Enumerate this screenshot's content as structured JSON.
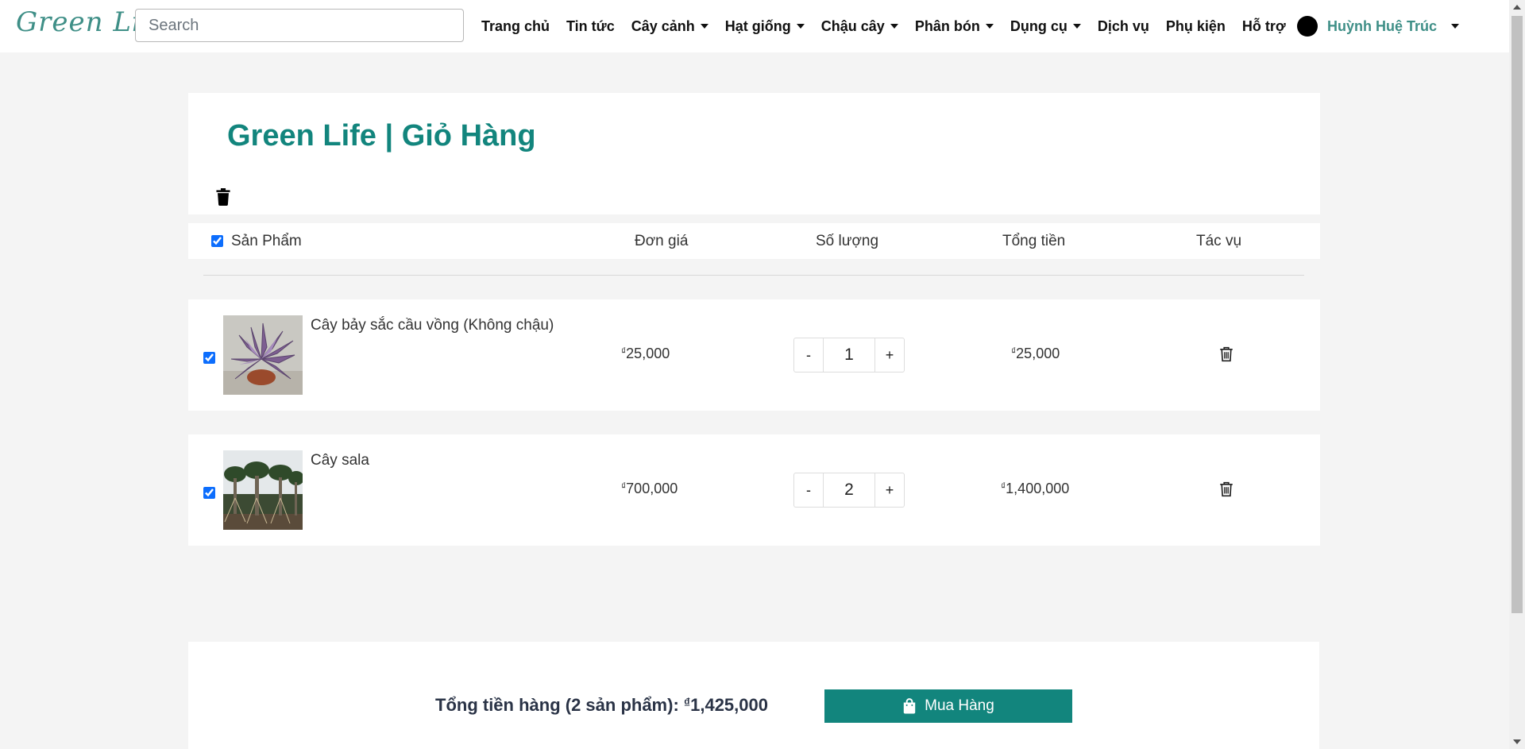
{
  "brand": {
    "logo_text": "Green Life",
    "accent": "#12857d"
  },
  "search": {
    "placeholder": "Search"
  },
  "nav": {
    "items": [
      {
        "label": "Trang chủ",
        "dropdown": false
      },
      {
        "label": "Tin tức",
        "dropdown": false
      },
      {
        "label": "Cây cảnh",
        "dropdown": true
      },
      {
        "label": "Hạt giống",
        "dropdown": true
      },
      {
        "label": "Chậu cây",
        "dropdown": true
      },
      {
        "label": "Phân bón",
        "dropdown": true
      },
      {
        "label": "Dụng cụ",
        "dropdown": true
      },
      {
        "label": "Dịch vụ",
        "dropdown": false
      },
      {
        "label": "Phụ kiện",
        "dropdown": false
      },
      {
        "label": "Hỗ trợ",
        "dropdown": false
      }
    ],
    "user_name": "Huỳnh Huệ Trúc"
  },
  "cart": {
    "title": "Green Life | Giỏ Hàng",
    "columns": {
      "product": "Sản Phẩm",
      "unit_price": "Đơn giá",
      "quantity": "Số lượng",
      "total": "Tổng tiền",
      "actions": "Tác vụ"
    },
    "select_all_checked": true,
    "currency_symbol": "₫",
    "items": [
      {
        "name": "Cây bảy sắc cầu vồng (Không chậu)",
        "unit_price": "25,000",
        "quantity": "1",
        "total": "25,000",
        "checked": true,
        "image_icon": "purple-plant-photo"
      },
      {
        "name": "Cây sala",
        "unit_price": "700,000",
        "quantity": "2",
        "total": "1,400,000",
        "checked": true,
        "image_icon": "sala-trees-photo"
      }
    ],
    "qty_minus": "-",
    "qty_plus": "+"
  },
  "summary": {
    "label": "Tổng tiền hàng (2 sản phẩm): ",
    "amount": "1,425,000",
    "buy_label": "Mua Hàng"
  }
}
